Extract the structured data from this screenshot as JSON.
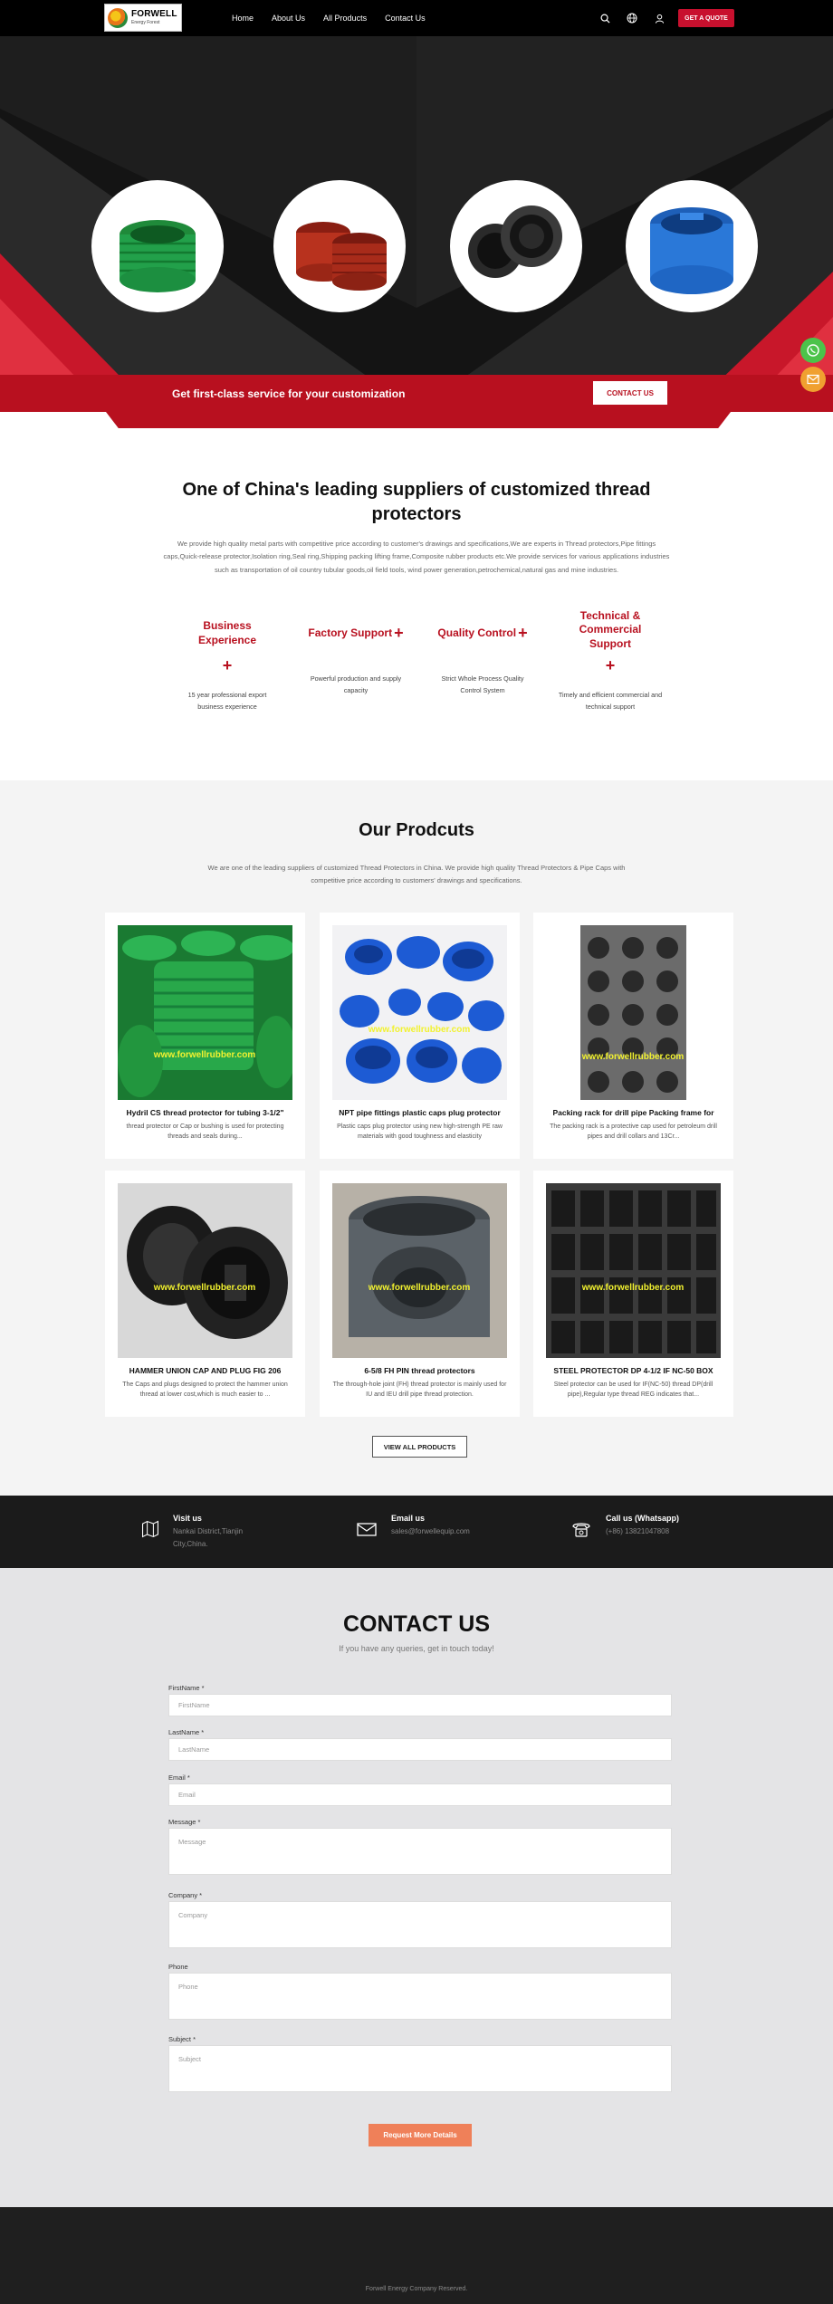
{
  "header": {
    "logo_name": "FORWELL",
    "logo_sub": "Energy Forest",
    "nav": [
      "Home",
      "About Us",
      "All Products",
      "Contact Us"
    ],
    "quote_button": "GET A QUOTE"
  },
  "colors": {
    "brand_red": "#c8102e",
    "dark": "#121212",
    "accent_orange": "#ef8059",
    "whatsapp_green": "#4cc34a",
    "mail_orange": "#f0a030"
  },
  "hero": {
    "circle_products": [
      "green-thread-protector",
      "red-thread-protector",
      "black-thread-protector",
      "blue-thread-protector"
    ],
    "bar_text": "Get first-class service for your customization",
    "bar_button": "CONTACT US"
  },
  "about": {
    "title": "One of China's leading suppliers of customized thread protectors",
    "text": "We provide high quality metal parts with competitive price according to customer's drawings and specifications,We are experts in Thread protectors,Pipe fittings caps,Quick-release protector,Isolation ring,Seal ring,Shipping packing lifting frame,Composite rubber products etc.We provide services for various applications industries such as transportation of oil country tubular goods,oil field tools, wind power generation,petrochemical,natural gas and mine industries.",
    "features": [
      {
        "title": "Business Experience",
        "text": "15 year professional export business experience"
      },
      {
        "title": "Factory Support",
        "text": "Powerful production and supply capacity"
      },
      {
        "title": "Quality Control",
        "text": "Strict Whole Process Quality Control System"
      },
      {
        "title": "Technical & Commercial Support",
        "text": "Timely and efficient commercial and technical support"
      }
    ]
  },
  "products": {
    "title": "Our Prodcuts",
    "subtitle": "We are one of the leading suppliers of customized Thread Protectors in China. We provide high quality Thread Protectors & Pipe Caps with competitive price according to customers' drawings and specifications.",
    "watermark": "www.forwellrubber.com",
    "items": [
      {
        "title": "Hydril CS thread protector for tubing 3-1/2\"",
        "desc": "thread protector or Cap or bushing is used for protecting threads and seals during..."
      },
      {
        "title": "NPT pipe fittings plastic caps plug protector",
        "desc": "Plastic caps plug protector using new high-strength PE raw materials with good toughness and elasticity"
      },
      {
        "title": "Packing rack for drill pipe Packing frame for",
        "desc": "The packing rack is a protective cap used for petroleum drill pipes and drill collars and 13Cr..."
      },
      {
        "title": "HAMMER UNION CAP AND PLUG FIG 206",
        "desc": "The Caps and plugs designed to protect the hammer union thread at lower cost,which is much easier to ..."
      },
      {
        "title": "6-5/8 FH PIN thread protectors",
        "desc": "The through-hole joint (FH) thread protector is mainly used for IU and IEU drill pipe thread protection."
      },
      {
        "title": "STEEL PROTECTOR DP 4-1/2 IF NC-50 BOX",
        "desc": "Steel protector can be used for IF(NC-50) thread DP(drill pipe),Regular type thread REG indicates that..."
      }
    ],
    "view_all": "VIEW ALL PRODUCTS"
  },
  "info": {
    "visit_label": "Visit us",
    "visit_value": "Nankai District,Tianjin City,China.",
    "email_label": "Email us",
    "email_value": "sales@forwellequip.com",
    "call_label": "Call us (Whatsapp)",
    "call_value": "(+86) 13821047808"
  },
  "contact": {
    "title": "CONTACT US",
    "subtitle": "If you have any queries, get in touch today!",
    "fields": [
      {
        "label": "FirstName *",
        "placeholder": "FirstName"
      },
      {
        "label": "LastName *",
        "placeholder": "LastName"
      },
      {
        "label": "Email *",
        "placeholder": "Email"
      },
      {
        "label": "Message *",
        "placeholder": "Message"
      },
      {
        "label": "Company *",
        "placeholder": "Company"
      },
      {
        "label": "Phone",
        "placeholder": "Phone"
      },
      {
        "label": "Subject *",
        "placeholder": "Subject"
      }
    ],
    "submit": "Request More Details"
  },
  "footer": {
    "copyright": "Forwell Energy Company Reserved."
  }
}
